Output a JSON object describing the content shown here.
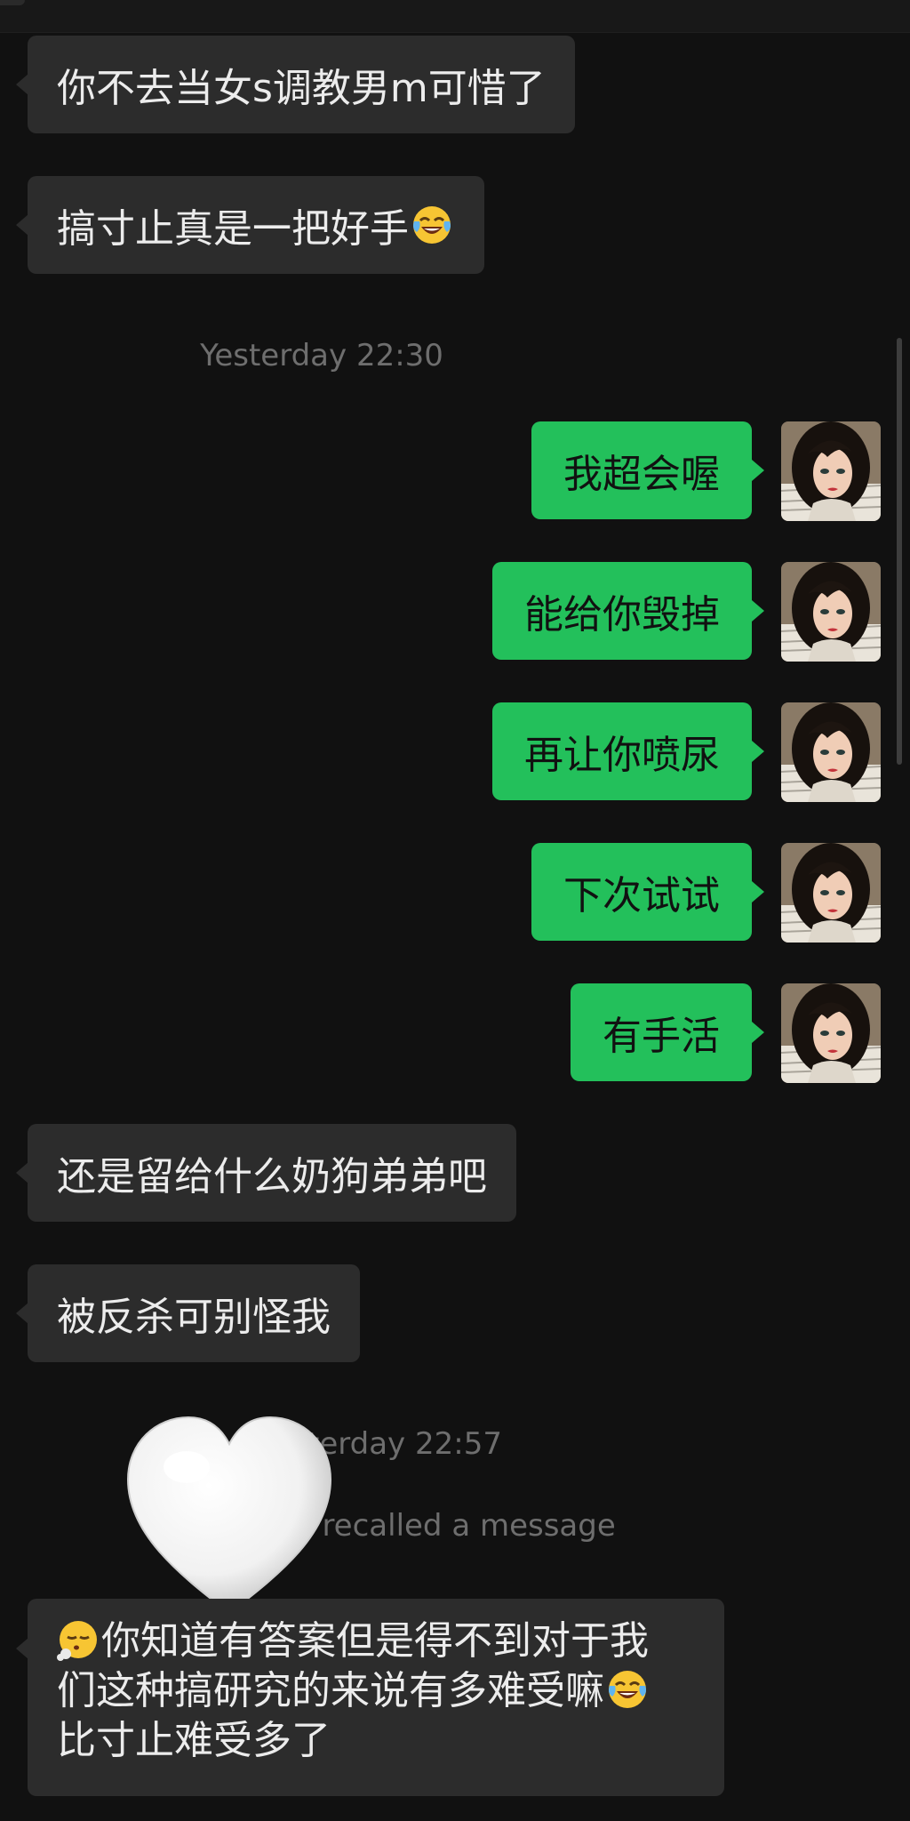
{
  "messages": {
    "in_1": "你不去当女s调教男m可惜了",
    "in_2": "搞寸止真是一把好手",
    "out_1": "我超会喔",
    "out_2": "能给你毁掉",
    "out_3": "再让你喷尿",
    "out_4": "下次试试",
    "out_5": "有手活",
    "in_3": "还是留给什么奶狗弟弟吧",
    "in_4": "被反杀可别怪我",
    "in_5_line1": "你知道有答案但是得不到对于我",
    "in_5_line2": "们这种搞研究的来说有多难受嘛",
    "in_5_line3": "比寸止难受多了"
  },
  "timestamps": {
    "t1": "Yesterday 22:30",
    "t2_visible": "terday 22:57"
  },
  "system": {
    "recalled_visible": "\" recalled a message"
  },
  "icons": {
    "laugh": "face-with-tears-of-joy-icon",
    "sigh": "face-exhaling-icon",
    "heart": "white-heart-sticker-icon",
    "avatar": "user-avatar-illustration"
  },
  "colors": {
    "background": "#111111",
    "bubble_in": "#2c2c2c",
    "bubble_out": "#23c05b",
    "timestamp": "#6e6e6e"
  }
}
